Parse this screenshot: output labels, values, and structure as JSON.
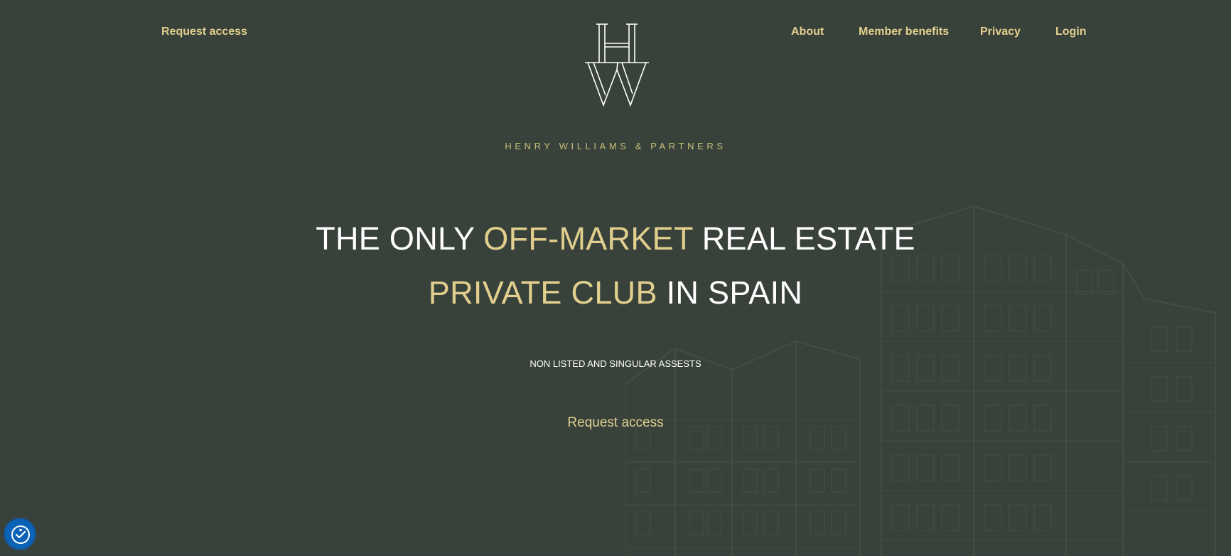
{
  "header": {
    "left_link": "Request access",
    "nav": {
      "about": "About",
      "member_benefits": "Member benefits",
      "privacy": "Privacy",
      "login": "Login"
    },
    "logo": {
      "letter_top": "H",
      "letter_bottom": "W",
      "brand_name": "HENRY WILLIAMS & PARTNERS"
    }
  },
  "hero": {
    "line1_a": "THE ONLY ",
    "line1_b": "OFF-MARKET",
    "line1_c": " REAL ESTATE",
    "line2_a": "PRIVATE CLUB",
    "line2_b": " IN SPAIN",
    "subtitle": "NON LISTED AND SINGULAR ASSESTS",
    "cta": "Request access"
  },
  "colors": {
    "background": "#38423b",
    "accent": "#e2cf8e",
    "text": "#ffffff",
    "accessibility_button": "#0b63b8"
  },
  "icons": {
    "logo": "hw-monogram-icon",
    "accessibility": "accessibility-icon",
    "background": "building-sketch-icon"
  }
}
